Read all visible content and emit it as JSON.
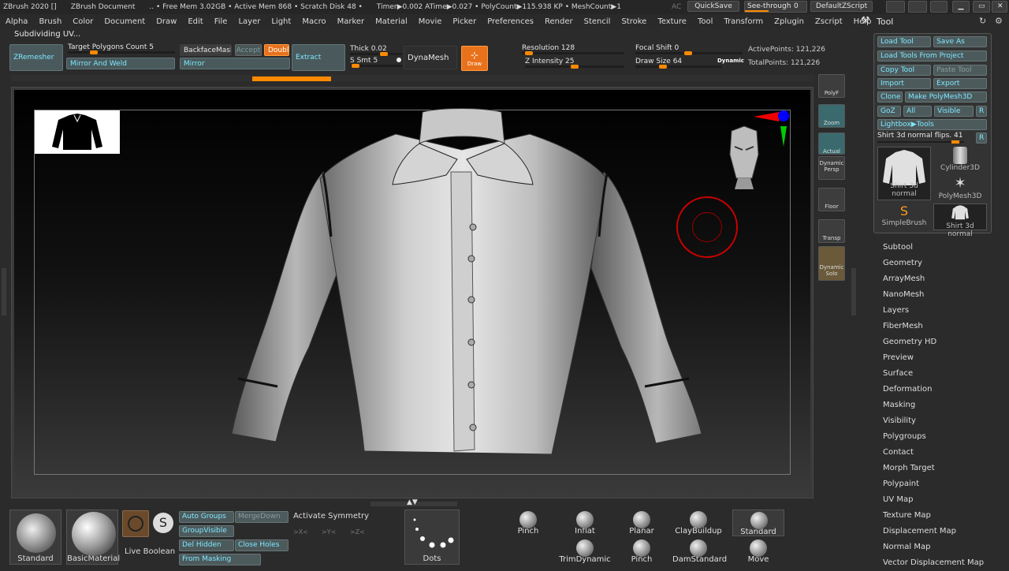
{
  "titlebar": {
    "items": [
      "ZBrush 2020 []",
      "ZBrush Document",
      ".. • Free Mem 3.02GB • Active Mem 868 • Scratch Disk 48 •",
      "Timer▶0.002 ATime▶0.027 • PolyCount▶115.938 KP • MeshCount▶1"
    ],
    "ac": "AC",
    "quicksave": "QuickSave",
    "seethrough": "See-through",
    "seethrough_value": "0",
    "defaultzscript": "DefaultZScript"
  },
  "menu": [
    "Alpha",
    "Brush",
    "Color",
    "Document",
    "Draw",
    "Edit",
    "File",
    "Layer",
    "Light",
    "Macro",
    "Marker",
    "Material",
    "Movie",
    "Picker",
    "Preferences",
    "Render",
    "Stencil",
    "Stroke",
    "Texture",
    "Tool",
    "Transform",
    "Zplugin",
    "Zscript",
    "Help"
  ],
  "status": "Subdividing UV...",
  "toolbar": {
    "zremesher": "ZRemesher",
    "target_label": "Target Polygons Count 5",
    "mirror_weld": "Mirror And Weld",
    "backface": "BackfaceMask",
    "accept": "Accept",
    "double": "Double",
    "mirror": "Mirror",
    "extract": "Extract",
    "thick": "Thick 0.02",
    "ssmt": "S Smt 5",
    "dynamesh": "DynaMesh",
    "draw": "Draw",
    "resolution": "Resolution 128",
    "zintensity": "Z Intensity 25",
    "focalshift": "Focal Shift 0",
    "drawsize": "Draw Size 64",
    "dynamic": "Dynamic",
    "activepoints": "ActivePoints: 121,226",
    "totalpoints": "TotalPoints: 121,226"
  },
  "shelf": {
    "polyf": "PolyF",
    "zoom": "Zoom",
    "actual": "Actual",
    "dynamic_persp": "Dynamic",
    "persp": "Persp",
    "floor": "Floor",
    "transp": "Transp",
    "solo": "Solo",
    "dynamic_solo": "Dynamic"
  },
  "toolpanel": {
    "title": "Tool",
    "load": "Load Tool",
    "saveas": "Save As",
    "loadproject": "Load Tools From Project",
    "copy": "Copy Tool",
    "paste": "Paste Tool",
    "import": "Import",
    "export": "Export",
    "clone": "Clone",
    "make": "Make PolyMesh3D",
    "goz": "GoZ",
    "all": "All",
    "visible": "Visible",
    "r": "R",
    "lightbox": "Lightbox▶Tools",
    "current": "Shirt 3d normal flips. 41",
    "r2": "R",
    "thumbs": [
      "Shirt 3d normal",
      "Cylinder3D",
      "PolyMesh3D",
      "SimpleBrush",
      "Shirt 3d normal"
    ]
  },
  "submenu": [
    "Subtool",
    "Geometry",
    "ArrayMesh",
    "NanoMesh",
    "Layers",
    "FiberMesh",
    "Geometry HD",
    "Preview",
    "Surface",
    "Deformation",
    "Masking",
    "Visibility",
    "Polygroups",
    "Contact",
    "Morph Target",
    "Polypaint",
    "UV Map",
    "Texture Map",
    "Displacement Map",
    "Normal Map",
    "Vector Displacement Map"
  ],
  "bottom": {
    "standard": "Standard",
    "basicmaterial": "BasicMaterial",
    "liveboolean": "Live Boolean",
    "autogroups": "Auto Groups",
    "mergedown": "MergeDown",
    "activatesym": "Activate Symmetry",
    "groupvisible": "GroupVisible",
    "sym_x": ">X<",
    "sym_y": ">Y<",
    "sym_z": ">Z<",
    "delhidden": "Del Hidden",
    "closeholes": "Close Holes",
    "frommasking": "From Masking",
    "dots": "Dots",
    "brushes": [
      "Pinch",
      "Inflat",
      "Planar",
      "ClayBuildup",
      "Standard",
      "TrimDynamic",
      "Pinch",
      "DamStandard",
      "Move"
    ]
  }
}
